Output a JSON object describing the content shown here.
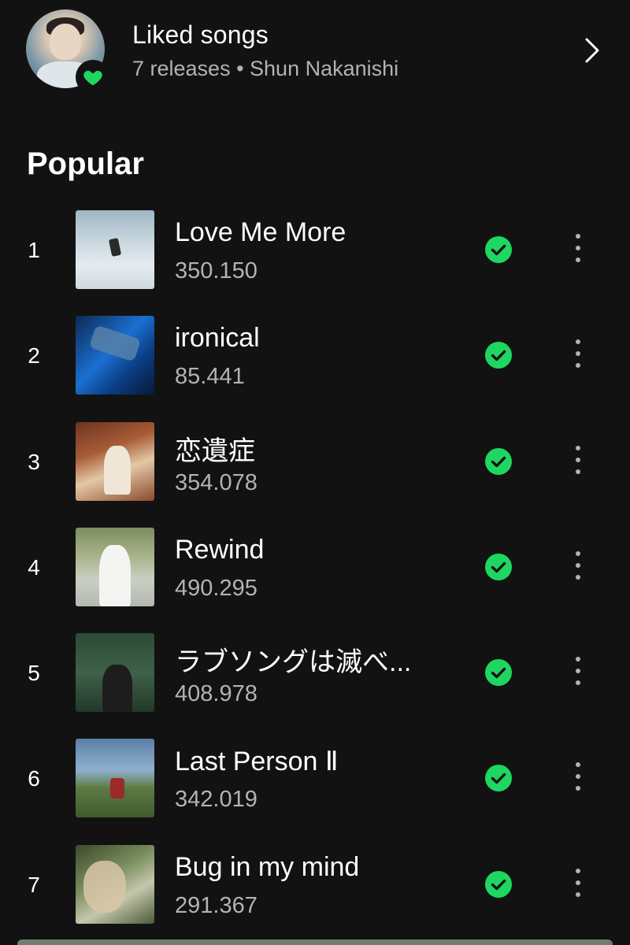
{
  "liked": {
    "title": "Liked songs",
    "subtitle": "7 releases • Shun Nakanishi"
  },
  "section": {
    "title": "Popular"
  },
  "tracks": [
    {
      "rank": "1",
      "title": "Love Me More",
      "plays": "350.150",
      "saved": true
    },
    {
      "rank": "2",
      "title": "ironical",
      "plays": "85.441",
      "saved": true
    },
    {
      "rank": "3",
      "title": "恋遺症",
      "plays": "354.078",
      "saved": true
    },
    {
      "rank": "4",
      "title": "Rewind",
      "plays": "490.295",
      "saved": true
    },
    {
      "rank": "5",
      "title": "ラブソングは滅べ...",
      "plays": "408.978",
      "saved": true
    },
    {
      "rank": "6",
      "title": "Last Person Ⅱ",
      "plays": "342.019",
      "saved": true
    },
    {
      "rank": "7",
      "title": "Bug in my mind",
      "plays": "291.367",
      "saved": true
    }
  ],
  "colors": {
    "background": "#121212",
    "accent_green": "#1ed760",
    "secondary_text": "#b3b3b3"
  },
  "icons": {
    "liked_badge": "heart-icon",
    "navigate": "chevron-right-icon",
    "saved": "check-circle-icon",
    "more": "more-vertical-icon"
  }
}
